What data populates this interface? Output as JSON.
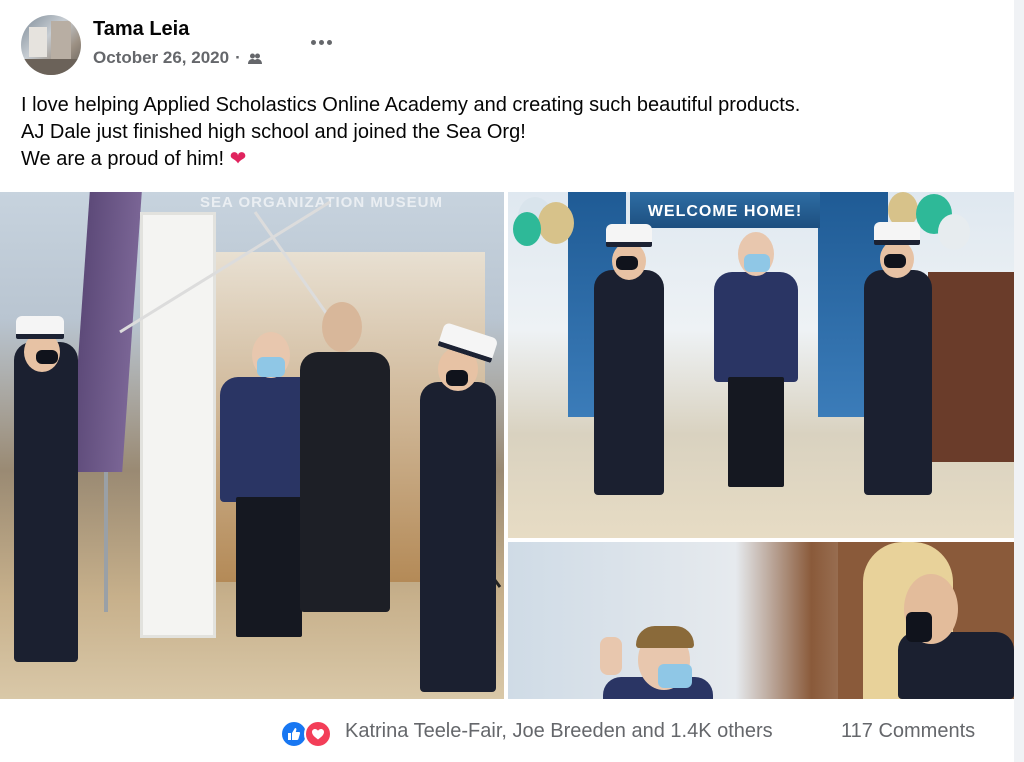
{
  "post": {
    "author": "Tama Leia",
    "date": "October 26, 2020",
    "date_separator": "·",
    "privacy_icon": "friends-icon",
    "more_icon": "more-horizontal-icon",
    "text_lines": [
      "I love helping Applied Scholastics Online Academy and creating such beautiful products.",
      "AJ Dale just finished high school and joined the Sea Org!",
      "We are a proud of him!"
    ],
    "emoji": "❤"
  },
  "photos": {
    "photo1_sign": "SEA ORGANIZATION MUSEUM",
    "photo2_banner": "WELCOME HOME!"
  },
  "footer": {
    "reaction_icons": [
      "like-icon",
      "love-icon"
    ],
    "reaction_names": "Katrina Teele-Fair, Joe Breeden and 1.4K others",
    "comments": "117 Comments"
  },
  "colors": {
    "primary_text": "#050505",
    "secondary_text": "#65676b",
    "like_blue": "#1877f2",
    "love_red": "#f33e58",
    "heart": "#e0245e"
  }
}
